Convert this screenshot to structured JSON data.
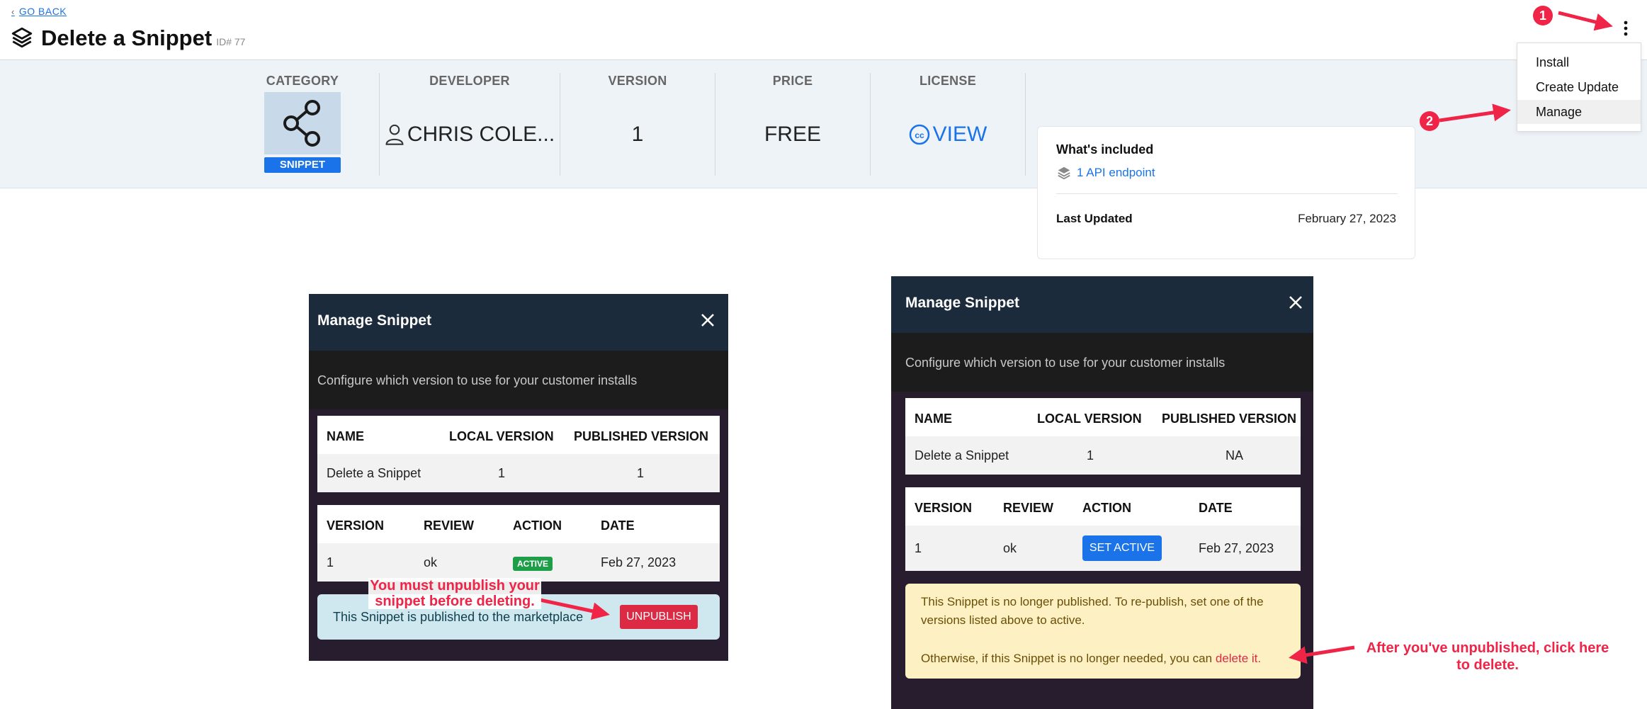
{
  "header": {
    "back_label": "GO BACK",
    "title": "Delete a Snippet",
    "id_label": "ID# 77"
  },
  "summary": {
    "category": {
      "label": "CATEGORY",
      "badge": "SNIPPET"
    },
    "developer": {
      "label": "DEVELOPER",
      "value": "CHRIS COLE..."
    },
    "version": {
      "label": "VERSION",
      "value": "1"
    },
    "price": {
      "label": "PRICE",
      "value": "FREE"
    },
    "license": {
      "label": "LICENSE",
      "value": "VIEW"
    }
  },
  "menu": {
    "items": [
      {
        "label": "Install"
      },
      {
        "label": "Create Update"
      },
      {
        "label": "Manage"
      }
    ]
  },
  "included": {
    "title": "What's included",
    "item": "1 API endpoint",
    "updated_label": "Last Updated",
    "updated_value": "February 27, 2023"
  },
  "modal_left": {
    "title": "Manage Snippet",
    "subtitle": "Configure which version to use for your customer installs",
    "table1": {
      "headers": [
        "NAME",
        "LOCAL VERSION",
        "PUBLISHED VERSION"
      ],
      "row": [
        "Delete a Snippet",
        "1",
        "1"
      ]
    },
    "table2": {
      "headers": [
        "VERSION",
        "REVIEW",
        "ACTION",
        "DATE"
      ],
      "row": [
        "1",
        "ok",
        "ACTIVE",
        "Feb 27, 2023"
      ]
    },
    "notice": "This Snippet is published to the marketplace",
    "unpublish_label": "UNPUBLISH"
  },
  "modal_right": {
    "title": "Manage Snippet",
    "subtitle": "Configure which version to use for your customer installs",
    "table1": {
      "headers": [
        "NAME",
        "LOCAL VERSION",
        "PUBLISHED VERSION"
      ],
      "row": [
        "Delete a Snippet",
        "1",
        "NA"
      ]
    },
    "table2": {
      "headers": [
        "VERSION",
        "REVIEW",
        "ACTION",
        "DATE"
      ],
      "row": [
        "1",
        "ok",
        "SET ACTIVE",
        "Feb 27, 2023"
      ]
    },
    "warning_line1": "This Snippet is no longer published. To re-publish, set one of the",
    "warning_line2": "versions listed above to active.",
    "warning_line3_prefix": "Otherwise, if this Snippet is no longer needed, you can",
    "warning_link": "delete it."
  },
  "annotations": {
    "step1": "1",
    "step2": "2",
    "unpublish_note_line1": "You must unpublish your",
    "unpublish_note_line2": "snippet before deleting.",
    "delete_note_line1": "After you've unpublished, click here",
    "delete_note_line2": "to delete."
  },
  "colors": {
    "accent": "#1a73e8",
    "annotation": "#ef2447",
    "active_badge": "#1e9e48",
    "modal_header": "#1b2b3b"
  }
}
